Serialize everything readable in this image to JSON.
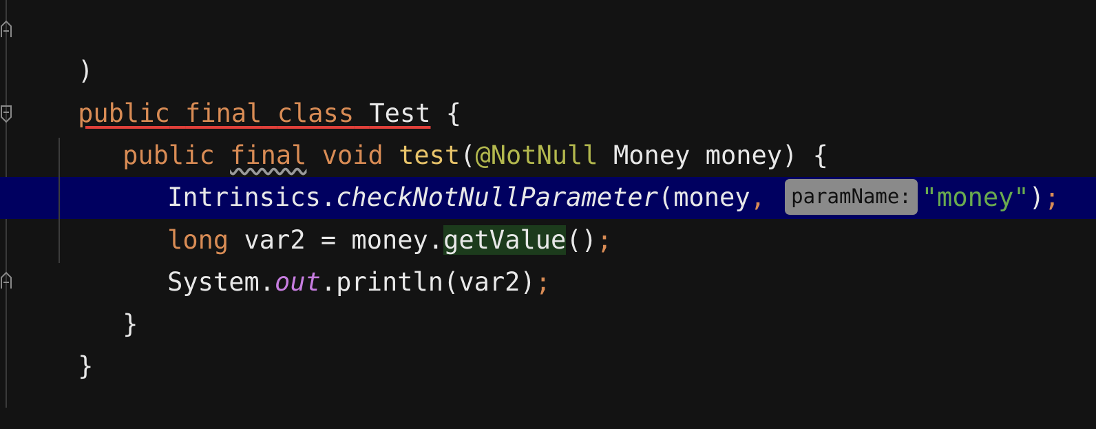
{
  "editor": {
    "lines": {
      "close_paren": ")",
      "class_decl": {
        "kw_public": "public",
        "kw_final": "final",
        "kw_class": "class",
        "name": "Test",
        "brace": "{"
      },
      "method_decl": {
        "kw_public": "public",
        "kw_final": "final",
        "kw_void": "void",
        "name": "test",
        "open_paren": "(",
        "annotation": "@NotNull",
        "param_type": "Money",
        "param_name": "money",
        "close": ")",
        "brace": "{"
      },
      "intrinsics": {
        "receiver": "Intrinsics.",
        "method": "checkNotNullParameter",
        "open": "(money",
        "comma": ",",
        "hint": "paramName:",
        "string": "\"money\"",
        "close": ")",
        "semi": ";"
      },
      "var_line": {
        "kw_long": "long",
        "text_before": "var2 = money.",
        "method": "getValue",
        "parens": "()",
        "semi": ";"
      },
      "println": {
        "receiver": "System.",
        "field": "out",
        "rest": ".println(var2)",
        "semi": ";"
      },
      "method_close": "}",
      "class_close": "}"
    },
    "colors": {
      "background": "#131313",
      "keyword": "#d98c55",
      "function": "#e8c46a",
      "annotation": "#b3b84e",
      "string": "#6aab4f",
      "static_field": "#c77de0",
      "current_line": "#000060",
      "error_underline": "#e0403a"
    }
  }
}
